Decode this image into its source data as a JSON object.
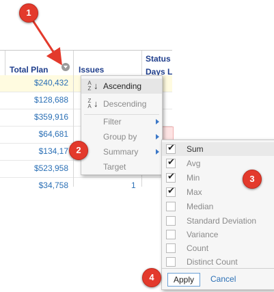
{
  "grid": {
    "headers": {
      "total_plan": "Total Plan",
      "issues": "Issues",
      "status_line1": "Status",
      "status_line2": "Days L"
    },
    "rows": [
      {
        "plan": "$240,432",
        "issue": ""
      },
      {
        "plan": "$128,688",
        "issue": ""
      },
      {
        "plan": "$359,916",
        "issue": ""
      },
      {
        "plan": "$64,681",
        "issue": ""
      },
      {
        "plan": "$134,17",
        "issue": ""
      },
      {
        "plan": "$523,958",
        "issue": ""
      },
      {
        "plan": "$34,758",
        "issue": "1"
      }
    ]
  },
  "menu": {
    "ascending": "Ascending",
    "descending": "Descending",
    "filter": "Filter",
    "group_by": "Group by",
    "summary": "Summary",
    "target": "Target",
    "sort_asc_top": "A",
    "sort_asc_bottom": "Z",
    "sort_desc_top": "Z",
    "sort_desc_bottom": "A"
  },
  "summary_options": [
    {
      "label": "Sum",
      "checked": true
    },
    {
      "label": "Avg",
      "checked": true
    },
    {
      "label": "Min",
      "checked": true
    },
    {
      "label": "Max",
      "checked": true
    },
    {
      "label": "Median",
      "checked": false
    },
    {
      "label": "Standard Deviation",
      "checked": false
    },
    {
      "label": "Variance",
      "checked": false
    },
    {
      "label": "Count",
      "checked": false
    },
    {
      "label": "Distinct Count",
      "checked": false
    }
  ],
  "actions": {
    "apply": "Apply",
    "cancel": "Cancel"
  },
  "callouts": {
    "c1": "1",
    "c2": "2",
    "c3": "3",
    "c4": "4"
  },
  "colors": {
    "callout": "#e33a2c",
    "link": "#2a6fb5",
    "header": "#1f3e8c"
  }
}
